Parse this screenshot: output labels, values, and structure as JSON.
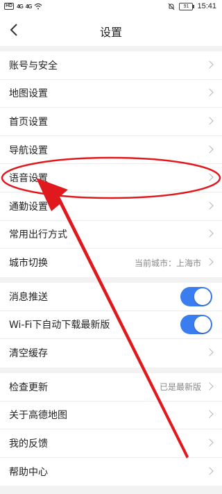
{
  "status_bar": {
    "chip1": "HD",
    "signal1": "4G",
    "signal2": "4G",
    "battery": "91",
    "time": "15:41"
  },
  "nav": {
    "back": "<",
    "title": "设置"
  },
  "groups": [
    {
      "rows": [
        {
          "label": "账号与安全"
        },
        {
          "label": "地图设置"
        },
        {
          "label": "首页设置"
        },
        {
          "label": "导航设置"
        },
        {
          "label": "语音设置"
        },
        {
          "label": "通勤设置"
        },
        {
          "label": "常用出行方式"
        },
        {
          "label": "城市切换",
          "value": "当前城市：上海市"
        }
      ]
    },
    {
      "rows": [
        {
          "label": "消息推送",
          "toggle": true
        },
        {
          "label": "Wi-Fi下自动下载最新版",
          "toggle": true
        },
        {
          "label": "清空缓存"
        }
      ]
    },
    {
      "rows": [
        {
          "label": "检查更新",
          "value": "已是最新版"
        },
        {
          "label": "关于高德地图"
        },
        {
          "label": "我的反馈"
        },
        {
          "label": "帮助中心"
        }
      ]
    }
  ],
  "colors": {
    "toggle_on": "#3a7df0",
    "annotation": "#e0191e"
  }
}
